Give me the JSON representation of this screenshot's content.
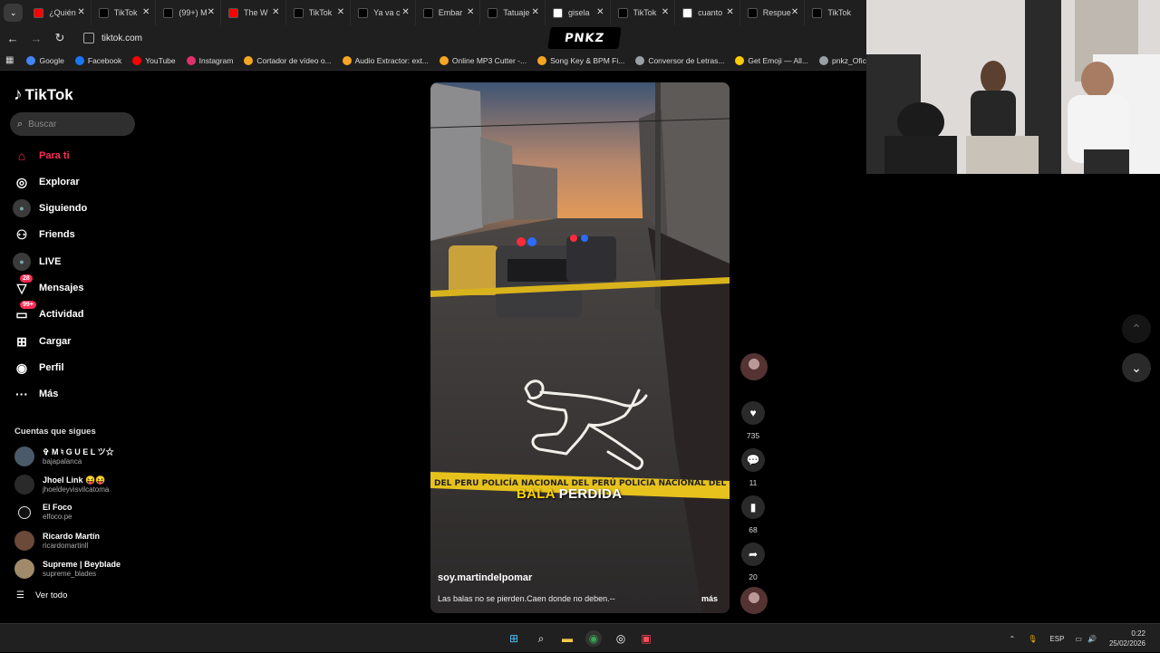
{
  "browser": {
    "tabs": [
      {
        "title": "¿Quién",
        "icon": "youtube-icon",
        "color": "#ff0000"
      },
      {
        "title": "TikTok",
        "icon": "tiktok-icon",
        "color": "#000000"
      },
      {
        "title": "(99+) M",
        "icon": "tiktok-icon",
        "color": "#000000"
      },
      {
        "title": "The W",
        "icon": "youtube-icon",
        "color": "#ff0000"
      },
      {
        "title": "TikTok",
        "icon": "tiktok-icon",
        "color": "#000000"
      },
      {
        "title": "Ya va c",
        "icon": "tiktok-icon",
        "color": "#000000"
      },
      {
        "title": "Embar",
        "icon": "tiktok-icon",
        "color": "#000000"
      },
      {
        "title": "Tatuaje",
        "icon": "tiktok-icon",
        "color": "#000000"
      },
      {
        "title": "gisela",
        "icon": "google-icon",
        "color": "#ffffff"
      },
      {
        "title": "TikTok",
        "icon": "tiktok-icon",
        "color": "#000000"
      },
      {
        "title": "cuanto",
        "icon": "google-icon",
        "color": "#ffffff"
      },
      {
        "title": "Respue",
        "icon": "tiktok-icon",
        "color": "#000000"
      },
      {
        "title": "TikTok",
        "icon": "tiktok-icon",
        "color": "#000000"
      }
    ],
    "url": "tiktok.com",
    "bookmarks": [
      {
        "label": "Google",
        "color": "#4285f4"
      },
      {
        "label": "Facebook",
        "color": "#1877f2"
      },
      {
        "label": "YouTube",
        "color": "#ff0000"
      },
      {
        "label": "Instagram",
        "color": "#e1306c"
      },
      {
        "label": "Cortador de vídeo o...",
        "color": "#f5a623"
      },
      {
        "label": "Audio Extractor: ext...",
        "color": "#f5a623"
      },
      {
        "label": "Online MP3 Cutter -...",
        "color": "#f5a623"
      },
      {
        "label": "Song Key & BPM Fi...",
        "color": "#f5a623"
      },
      {
        "label": "Conversor de Letras...",
        "color": "#9aa0a6"
      },
      {
        "label": "Get Emoji — All...",
        "color": "#ffcc00"
      },
      {
        "label": "pnkz_Oficial - Tri",
        "color": "#9aa0a6"
      }
    ]
  },
  "overlay": {
    "brand": "PNKZ"
  },
  "tiktok": {
    "logo": "TikTok",
    "search_placeholder": "Buscar",
    "nav": [
      {
        "label": "Para ti",
        "icon": "home-icon",
        "active": true
      },
      {
        "label": "Explorar",
        "icon": "compass-icon"
      },
      {
        "label": "Siguiendo",
        "icon": "following-icon"
      },
      {
        "label": "Friends",
        "icon": "friends-icon"
      },
      {
        "label": "LIVE",
        "icon": "live-icon"
      },
      {
        "label": "Mensajes",
        "icon": "messages-icon",
        "badge": "28"
      },
      {
        "label": "Actividad",
        "icon": "activity-icon",
        "badge": "99+"
      },
      {
        "label": "Cargar",
        "icon": "upload-icon"
      },
      {
        "label": "Perfil",
        "icon": "profile-icon"
      },
      {
        "label": "Más",
        "icon": "more-icon"
      }
    ],
    "following_title": "Cuentas que sigues",
    "following": [
      {
        "name": "✞ M ♮ G U E L ツ☆",
        "handle": "bajapalanca"
      },
      {
        "name": "Jhoel Link 😝😝",
        "handle": "jhoeldeyvisvilcatoma"
      },
      {
        "name": "El Foco",
        "handle": "elfoco.pe"
      },
      {
        "name": "Ricardo Martín",
        "handle": "ricardomartinll"
      },
      {
        "name": "Supreme | Beyblade",
        "handle": "supreme_blades"
      }
    ],
    "see_all": "Ver todo",
    "video": {
      "caption_highlight": "BALA",
      "caption_rest": " PERDIDA",
      "tape_text": "DEL PERU  POLICÍA NACIONAL DEL PERÚ  POLICIA NACIONAL DEL PERU",
      "author": "soy.martindelpomar",
      "description": "Las balas no se pierden.Caen donde no deben.--",
      "more": "más"
    },
    "actions": {
      "likes": "735",
      "comments": "11",
      "saves": "68",
      "shares": "20"
    }
  },
  "taskbar": {
    "language": "ESP",
    "time": "0:22",
    "date": "25/02/2026"
  }
}
